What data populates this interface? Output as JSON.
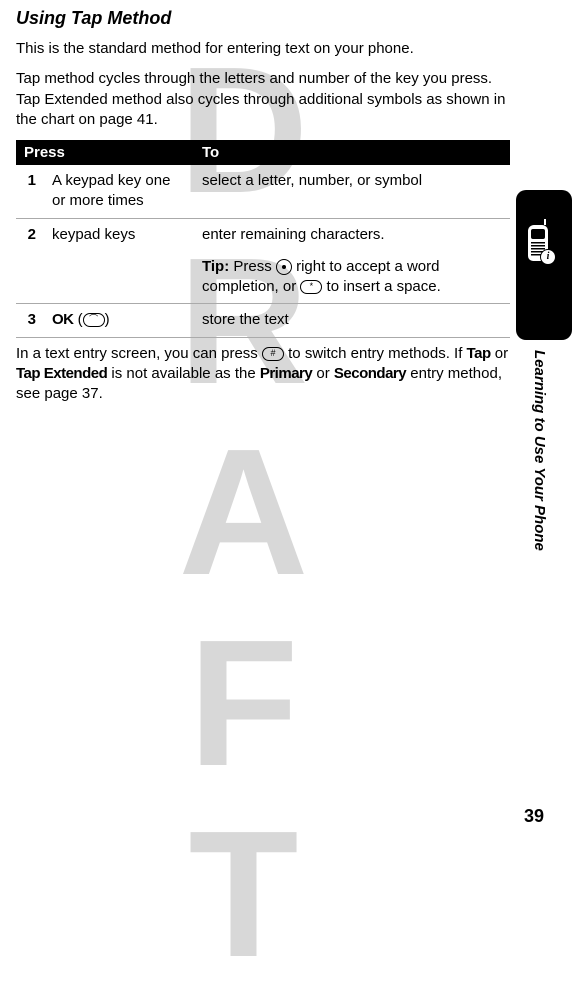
{
  "watermark": "DRAFT",
  "heading": "Using Tap Method",
  "para1": "This is the standard method for entering text on your phone.",
  "para2": "Tap method cycles through the letters and number of the key you press. Tap Extended method also cycles through additional symbols as shown in the chart on page 41.",
  "table": {
    "headers": {
      "press": "Press",
      "to": "To"
    },
    "rows": [
      {
        "num": "1",
        "press": "A keypad key one or more times",
        "to": "select a letter, number, or symbol"
      },
      {
        "num": "2",
        "press": "keypad keys",
        "to_line1": "enter remaining characters.",
        "tip_prefix": "Tip:",
        "tip_a": " Press ",
        "tip_b": " right to accept a word completion, or ",
        "tip_c": " to insert a space."
      },
      {
        "num": "3",
        "ok_label": "OK",
        "ok_key": "",
        "to": "store the text"
      }
    ]
  },
  "para3_a": "In a text entry screen, you can press ",
  "para3_b": " to switch entry methods. If ",
  "para3_tap": "Tap",
  "para3_or": " or ",
  "para3_tapext": "Tap Extended",
  "para3_c": " is not available as the ",
  "para3_primary": "Primary",
  "para3_d": " or ",
  "para3_secondary": "Secondary",
  "para3_e": " entry method, see page 37.",
  "vertical_label": "Learning to Use Your Phone",
  "page_number": "39",
  "keys": {
    "star": "*",
    "hash": "#",
    "softright": "⌒"
  },
  "info_badge": "i"
}
